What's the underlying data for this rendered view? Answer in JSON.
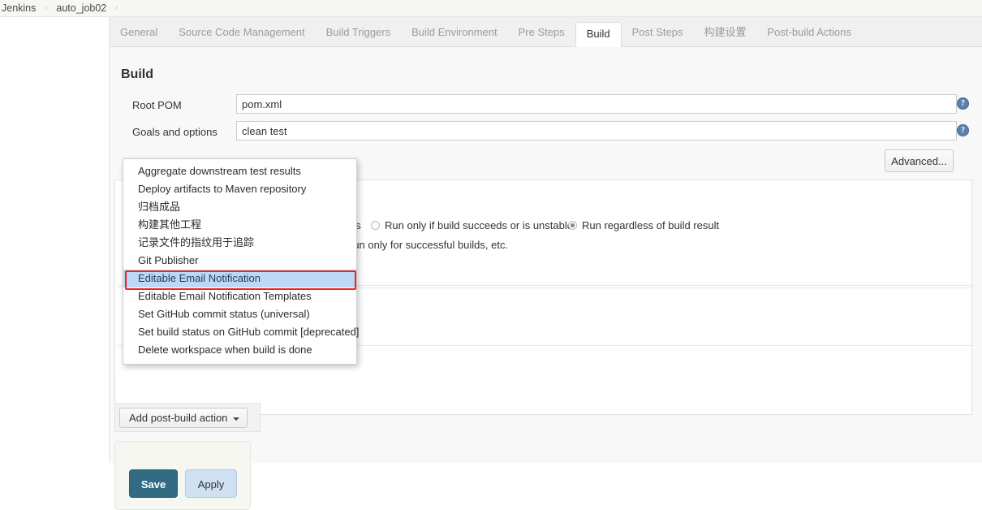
{
  "breadcrumb": {
    "items": [
      {
        "label": "Jenkins"
      },
      {
        "label": "auto_job02"
      }
    ],
    "separator": "›"
  },
  "tabs": [
    {
      "label": "General",
      "active": false
    },
    {
      "label": "Source Code Management",
      "active": false
    },
    {
      "label": "Build Triggers",
      "active": false
    },
    {
      "label": "Build Environment",
      "active": false
    },
    {
      "label": "Pre Steps",
      "active": false
    },
    {
      "label": "Build",
      "active": true
    },
    {
      "label": "Post Steps",
      "active": false
    },
    {
      "label": "构建设置",
      "active": false
    },
    {
      "label": "Post-build Actions",
      "active": false
    }
  ],
  "build_section": {
    "title": "Build",
    "fields": [
      {
        "label": "Root POM",
        "value": "pom.xml",
        "placeholder": "",
        "help_icon": "help-icon",
        "help_glyph": "?"
      },
      {
        "label": "Goals and options",
        "value": "clean test",
        "placeholder": "",
        "help_icon": "help-icon",
        "help_glyph": "?"
      }
    ],
    "advanced_button": "Advanced..."
  },
  "post_build": {
    "trigger_row": {
      "truncated_prefix": "ds",
      "option_unstable": "Run only if build succeeds or is unstable",
      "option_regardless": "Run regardless of build result",
      "selected": "option_regardless"
    },
    "hint_text": "run only for successful builds, etc.",
    "add_action_button": "Add post-build action",
    "caret_icon": "chevron-down-icon"
  },
  "dropdown": {
    "items": [
      {
        "label": "Aggregate downstream test results",
        "highlighted": false
      },
      {
        "label": "Deploy artifacts to Maven repository",
        "highlighted": false
      },
      {
        "label": "归档成品",
        "highlighted": false
      },
      {
        "label": "构建其他工程",
        "highlighted": false
      },
      {
        "label": "记录文件的指纹用于追踪",
        "highlighted": false
      },
      {
        "label": "Git Publisher",
        "highlighted": false
      },
      {
        "label": "Editable Email Notification",
        "highlighted": true
      },
      {
        "label": "Editable Email Notification Templates",
        "highlighted": false
      },
      {
        "label": "Set GitHub commit status (universal)",
        "highlighted": false
      },
      {
        "label": "Set build status on GitHub commit [deprecated]",
        "highlighted": false
      },
      {
        "label": "Delete workspace when build is done",
        "highlighted": false
      }
    ]
  },
  "footer": {
    "save_label": "Save",
    "apply_label": "Apply"
  },
  "colors": {
    "highlight_outline": "#ee2222",
    "menu_highlight_bg": "#bcd8f5",
    "save_bg": "#316b84",
    "apply_bg": "#cfe0f2",
    "help_icon_bg": "#5c7fb0"
  }
}
